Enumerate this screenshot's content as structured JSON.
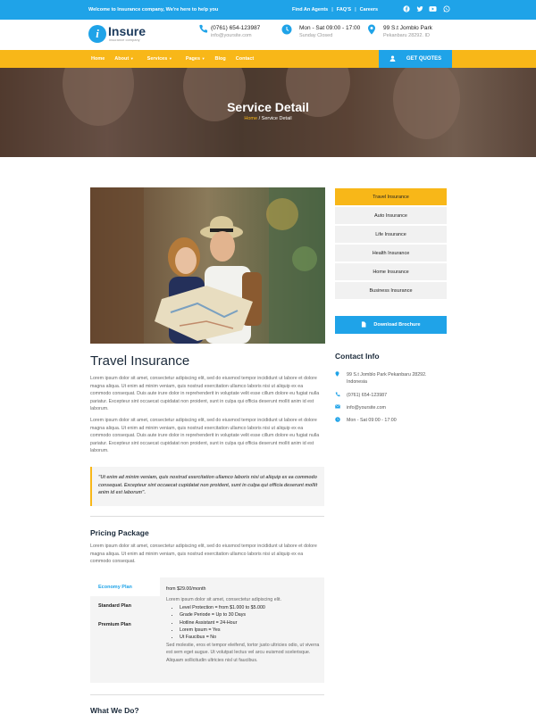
{
  "topbar": {
    "welcome": "Welcome to Insurance company, We're here to help you",
    "links": [
      "Find An Agents",
      "FAQ'S",
      "Careers"
    ],
    "social_icons": [
      "facebook-icon",
      "twitter-icon",
      "youtube-icon",
      "whatsapp-icon"
    ]
  },
  "header": {
    "logo_letter": "i",
    "logo_name": "Insure",
    "logo_tagline": "insurance company",
    "phone": "(0761) 654-123987",
    "email": "info@yoursite.com",
    "hours": "Mon - Sat 09:00 - 17:00",
    "hours_note": "Sunday Closed",
    "address": "99 S.t Jomblo Park",
    "address_note": "Pekanbaru 28292. ID"
  },
  "nav": {
    "items": [
      "Home",
      "About",
      "Services",
      "Pages",
      "Blog",
      "Contact"
    ],
    "quote_label": "GET QUOTES"
  },
  "hero": {
    "title": "Service Detail",
    "crumb_home": "Home",
    "crumb_current": "/ Service Detail"
  },
  "main": {
    "title": "Travel Insurance",
    "para1": "Lorem ipsum dolor sit amet, consectetur adipiscing elit, sed do eiusmod tempor incididunt ut labore et dolore magna aliqua. Ut enim ad minim veniam, quis nostrud exercitation ullamco laboris nisi ut aliquip ex ea commodo consequat. Duis aute irure dolor in reprehenderit in voluptate velit esse cillum dolore eu fugiat nulla pariatur. Excepteur sint occaecat cupidatat non proident, sunt in culpa qui officia deserunt mollit anim id est laborum.",
    "para2": "Lorem ipsum dolor sit amet, consectetur adipiscing elit, sed do eiusmod tempor incididunt ut labore et dolore magna aliqua. Ut enim ad minim veniam, quis nostrud exercitation ullamco laboris nisi ut aliquip ex ea commodo consequat. Duis aute irure dolor in reprehenderit in voluptate velit esse cillum dolore eu fugiat nulla pariatur. Excepteur sint occaecat cupidatat non proident, sunt in culpa qui officia deserunt mollit anim id est laborum.",
    "quote": "\"Ut enim ad minim veniam, quis nostrud exercitation ullamco laboris nisi ut aliquip ex ea commodo consequat. Excepteur sint occaecat cupidatat non proident, sunt in culpa qui officia deserunt mollit anim id est laborum\".",
    "pricing_title": "Pricing Package",
    "pricing_text": "Lorem ipsum dolor sit amet, consectetur adipiscing elit, sed do eiusmod tempor incididunt ut labore et dolore magna aliqua. Ut enim ad minim veniam, quis nostrud exercitation ullamco laboris nisi ut aliquip ex ea commodo consequat.",
    "plans": [
      "Economy Plan",
      "Standard Plan",
      "Premium Plan"
    ],
    "plan_price": "from $29.00/month",
    "plan_intro": "Lorem ipsum dolor sit amet, consectetur adipiscing elit.",
    "plan_features": [
      "Level Protection = from $1.000 to $5.000",
      "Grade Periode = Up to 30 Days",
      "Hotline Assistant = 24-Hour",
      "Lorem Ipsum = Yes",
      "Ut Faucibus = No"
    ],
    "plan_desc": "Sed molestie, eros et tempor eleifend, tortor justo ultricies odio, ut viverra est sem eget augue. Ut volutpat lectus vel arcu euismod scelerisque. Aliquam sollicitudin ultricies nisl ut faucibus.",
    "what_title": "What We Do?"
  },
  "sidebar": {
    "services": [
      "Travel Insurance",
      "Auto Insurance",
      "Life Insurance",
      "Health Insurance",
      "Home Insurance",
      "Business Insurance"
    ],
    "brochure_label": "Download Brochure",
    "contact_title": "Contact Info",
    "contact_address": "99 S.t Jomblo Park Pekanbaru 28292. Indonesia",
    "contact_phone": "(0761) 654-123987",
    "contact_email": "info@yoursite.com",
    "contact_hours": "Mon - Sat 09:00 - 17:00"
  },
  "colors": {
    "primary": "#1fa3e8",
    "accent": "#f8b718",
    "dark": "#1b2a3a"
  }
}
